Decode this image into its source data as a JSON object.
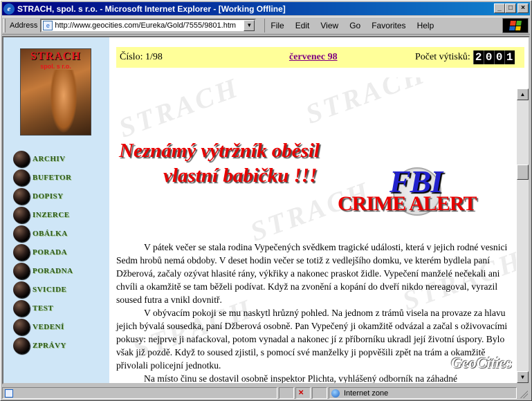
{
  "window": {
    "title": "STRACH, spol. s r.o. - Microsoft Internet Explorer - [Working Offline]"
  },
  "toolbar": {
    "address_label": "Address",
    "url": "http://www.geocities.com/Eureka/Gold/7555/9801.htm",
    "menus": [
      "File",
      "Edit",
      "View",
      "Go",
      "Favorites",
      "Help"
    ]
  },
  "sidebar": {
    "cover_title": "STRACH",
    "cover_subtitle": "spol. s r.o.",
    "items": [
      {
        "label": "ARCHIV"
      },
      {
        "label": "BUFETOR"
      },
      {
        "label": "DOPISY"
      },
      {
        "label": "INZERCE"
      },
      {
        "label": "OBÁLKA"
      },
      {
        "label": "PORADA"
      },
      {
        "label": "PORADNA"
      },
      {
        "label": "SVICIDE"
      },
      {
        "label": "TEST"
      },
      {
        "label": "VEDENÍ"
      },
      {
        "label": "ZPRÁVY"
      }
    ]
  },
  "header": {
    "issue": "Číslo: 1/98",
    "month": "červenec 98",
    "copies_label": "Počet výtisků:",
    "counter_digits": [
      "2",
      "0",
      "0",
      "1"
    ]
  },
  "article": {
    "headline_line1": "Neznámý výtržník oběsil",
    "headline_line2": "vlastní babičku !!!",
    "logo_fbi": "FBI",
    "logo_crime_alert": "CRIME ALERT",
    "paragraphs": [
      "V pátek večer se stala rodina Vypečených svědkem tragické události, která v jejich rodné vesnici Sedm hrobů nemá obdoby. V deset hodin večer se totiž z vedlejšího domku, ve kterém bydlela paní Džberová, začaly ozývat hlasité rány, výkřiky a nakonec praskot židle. Vypečení manželé nečekali ani chvíli a okamžitě se tam běželi podívat. Když na zvonění a kopání do dveří nikdo nereagoval, vyrazil soused futra a vnikl dovnitř.",
      "V obývacím pokoji se mu naskytl hrůzný pohled. Na jednom z trámů visela na provaze za hlavu jejich bývalá sousedka, paní Džberová osobně. Pan Vypečený ji okamžitě odvázal a začal s oživovacími pokusy: nejprve ji nafackoval, potom vynadal a nakonec jí z příborníku ukradl její životní úspory. Bylo však již pozdě. Když to soused zjistil, s pomocí své manželky ji popvěšili zpět na trám a okamžitě přivolali policejní jednotku.",
      "Na místo činu se dostavil osobně inspektor Plichta, vyhlášený odborník na záhadné"
    ],
    "watermark": "GeoCities"
  },
  "statusbar": {
    "zone": "Internet zone"
  }
}
